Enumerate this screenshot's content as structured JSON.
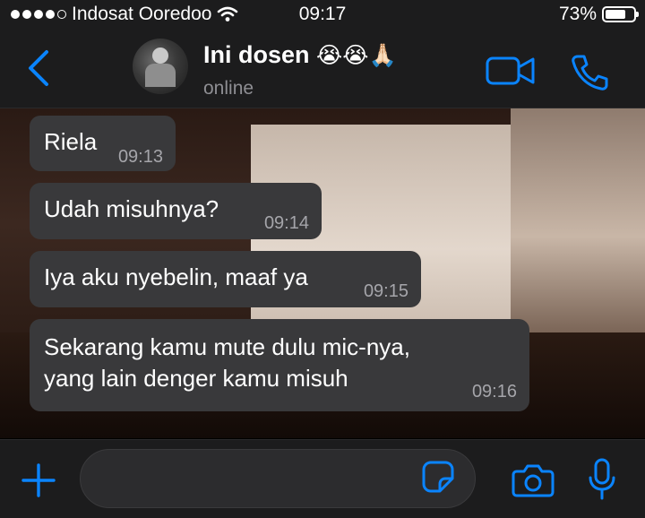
{
  "status_bar": {
    "carrier": "Indosat Ooredoo",
    "time": "09:17",
    "battery_percent": "73%",
    "battery_level": 0.73,
    "signal_bars_filled": 4,
    "signal_bars_total": 5
  },
  "header": {
    "contact_name": "Ini dosen",
    "contact_emoji": "😭😭🙏🏻",
    "contact_status": "online",
    "icons": [
      "chevron-left-icon",
      "video-camera-icon",
      "phone-icon"
    ]
  },
  "messages": [
    {
      "text": "Riela",
      "time": "09:13"
    },
    {
      "text": "Udah misuhnya?",
      "time": "09:14"
    },
    {
      "text": "Iya aku nyebelin, maaf ya",
      "time": "09:15"
    },
    {
      "text": "Sekarang kamu mute dulu mic-nya,\nyang lain denger kamu misuh",
      "time": "09:16"
    }
  ],
  "input_bar": {
    "icons": [
      "plus-icon",
      "sticker-icon",
      "camera-icon",
      "microphone-icon"
    ]
  },
  "colors": {
    "accent": "#0a84ff",
    "bar_background": "#1c1c1d",
    "bubble_background": "#39393b",
    "secondary_text": "#8e8e93"
  }
}
